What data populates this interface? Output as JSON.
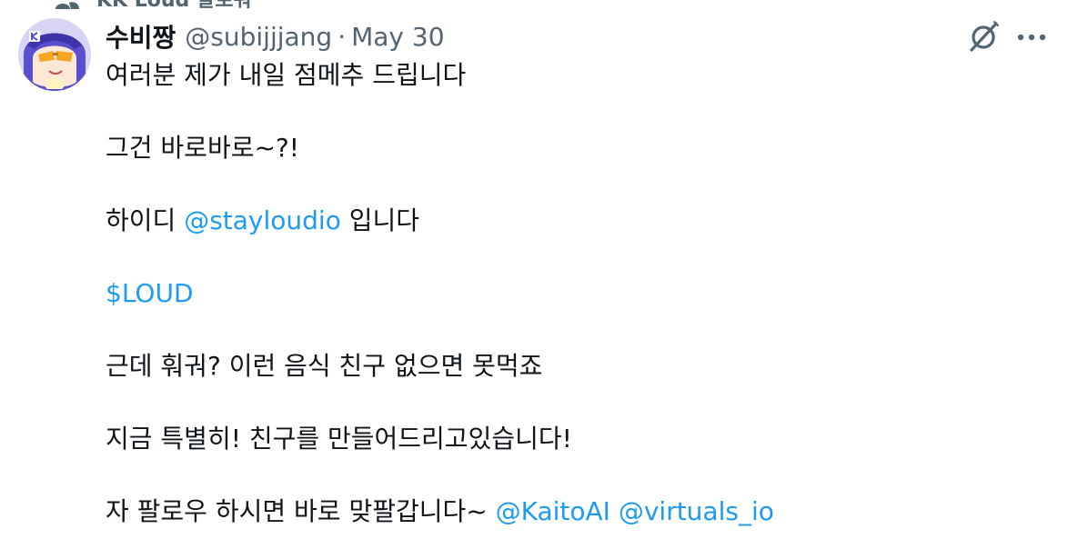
{
  "context": {
    "label": "KK Loud 팔로워"
  },
  "author": {
    "name": "수비짱",
    "handle": "@subijjjang",
    "separator": "·",
    "date": "May 30"
  },
  "tweet": {
    "line1": "여러분 제가 내일 점메추 드립니다",
    "line2": "그건 바로바로~?!",
    "line3_prefix": "하이디 ",
    "line3_mention": "@stayloudio",
    "line3_suffix": " 입니다",
    "cashtag": "$LOUD",
    "line5": "근데 훠궈? 이런 음식 친구 없으면 못먹죠",
    "line6": "지금 특별히! 친구를 만들어드리고있습니다!",
    "line7_prefix": "자 팔로우 하시면 바로 맞팔갑니다~ ",
    "line7_mention1": "@KaitoAI",
    "line7_space": " ",
    "line7_mention2": "@virtuals_io"
  },
  "icons": {
    "context": "people-icon",
    "avatar": "avatar-image",
    "grok": "grok-icon",
    "more": "more-icon"
  },
  "colors": {
    "text": "#0f1419",
    "secondary": "#536471",
    "link": "#1d9bf0",
    "avatar_bg": "#d8d4f4",
    "avatar_hair": "#5a4fcf",
    "avatar_glasses": "#f5a623"
  }
}
